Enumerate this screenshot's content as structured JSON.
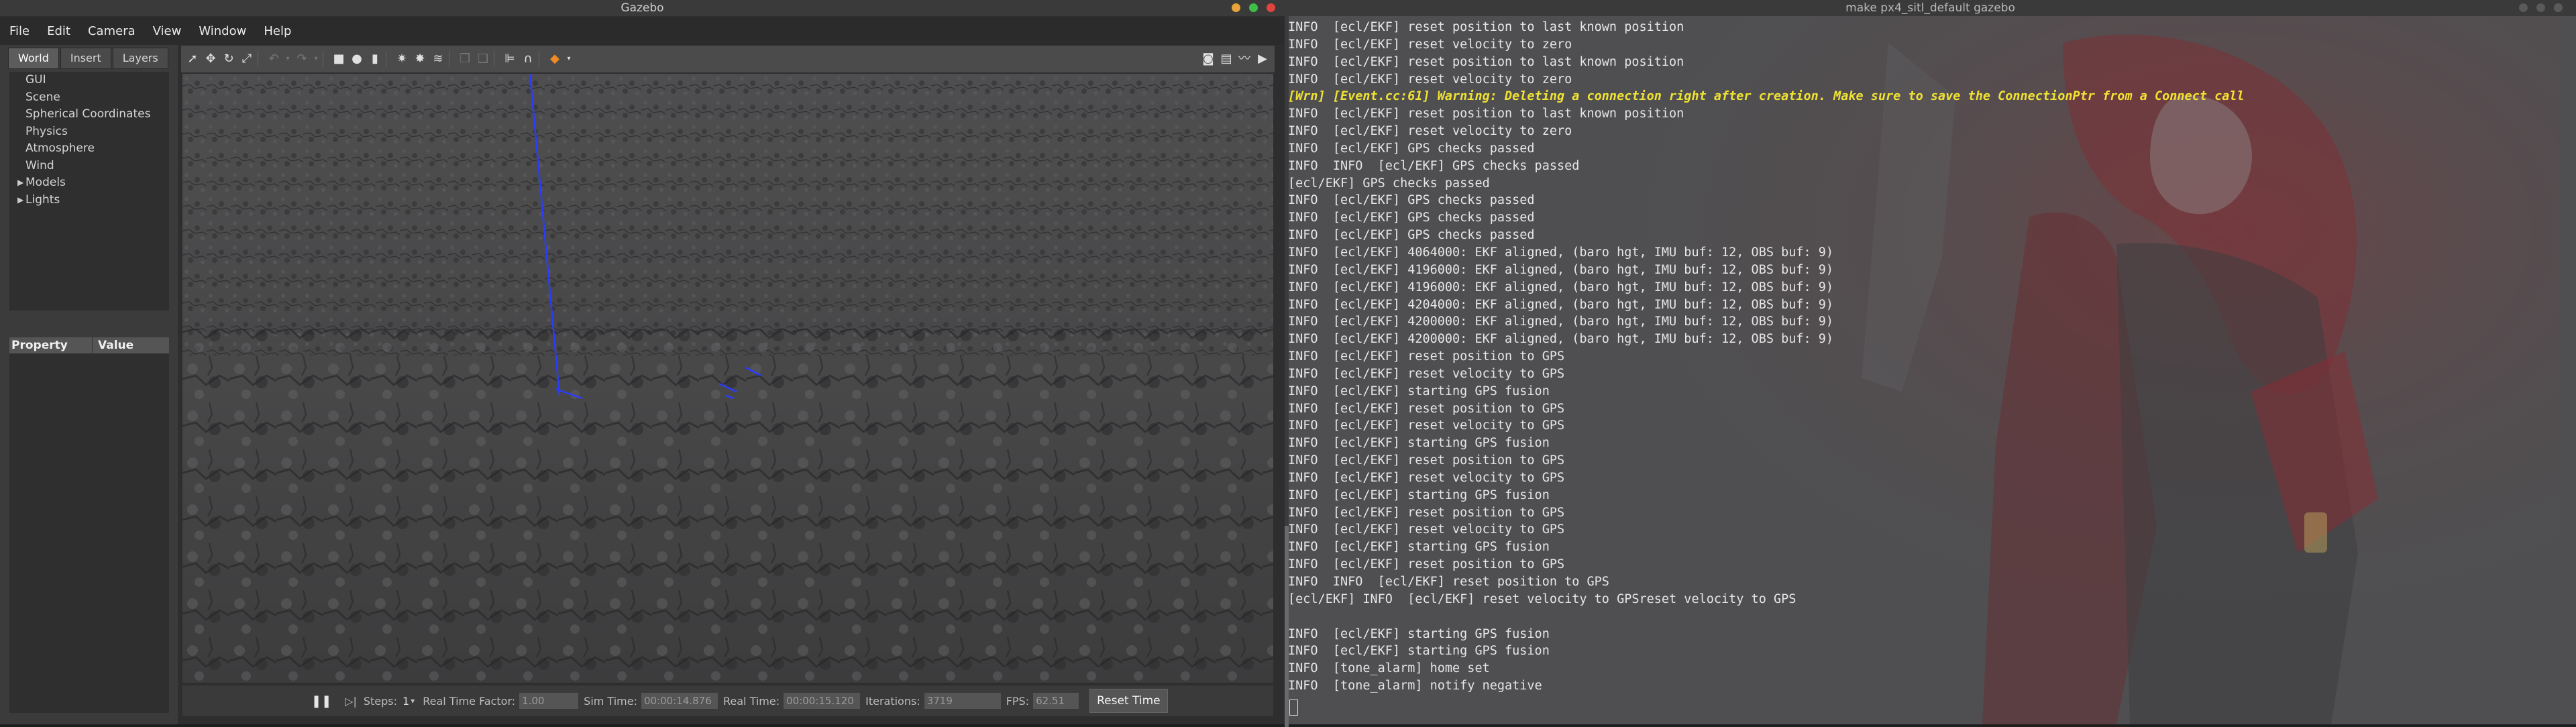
{
  "gazebo": {
    "title": "Gazebo",
    "menu": [
      "File",
      "Edit",
      "Camera",
      "View",
      "Window",
      "Help"
    ],
    "tabs": [
      "World",
      "Insert",
      "Layers"
    ],
    "tree": [
      {
        "label": "GUI",
        "expandable": false
      },
      {
        "label": "Scene",
        "expandable": false
      },
      {
        "label": "Spherical Coordinates",
        "expandable": false
      },
      {
        "label": "Physics",
        "expandable": false
      },
      {
        "label": "Atmosphere",
        "expandable": false
      },
      {
        "label": "Wind",
        "expandable": false
      },
      {
        "label": "Models",
        "expandable": true
      },
      {
        "label": "Lights",
        "expandable": true
      }
    ],
    "props": {
      "col1": "Property",
      "col2": "Value"
    },
    "bottom": {
      "steps_label": "Steps:",
      "steps_value": "1",
      "rtf_label": "Real Time Factor:",
      "rtf_value": "1.00",
      "sim_time_label": "Sim Time:",
      "sim_time_value": "00:00:14.876",
      "real_time_label": "Real Time:",
      "real_time_value": "00:00:15.120",
      "iterations_label": "Iterations:",
      "iterations_value": "3719",
      "fps_label": "FPS:",
      "fps_value": "62.51",
      "reset_label": "Reset Time"
    }
  },
  "terminal": {
    "title": "make px4_sitl_default gazebo",
    "lines": [
      {
        "text": "INFO  [ecl/EKF] reset position to last known position",
        "style": "normal"
      },
      {
        "text": "INFO  [ecl/EKF] reset velocity to zero",
        "style": "normal"
      },
      {
        "text": "INFO  [ecl/EKF] reset position to last known position",
        "style": "normal"
      },
      {
        "text": "INFO  [ecl/EKF] reset velocity to zero",
        "style": "normal"
      },
      {
        "text": "[Wrn] [Event.cc:61] Warning: Deleting a connection right after creation. Make sure to save the ConnectionPtr from a Connect call",
        "style": "warn"
      },
      {
        "text": "INFO  [ecl/EKF] reset position to last known position",
        "style": "normal"
      },
      {
        "text": "INFO  [ecl/EKF] reset velocity to zero",
        "style": "normal"
      },
      {
        "text": "INFO  [ecl/EKF] GPS checks passed",
        "style": "normal"
      },
      {
        "text": "INFO  INFO  [ecl/EKF] GPS checks passed",
        "style": "normal"
      },
      {
        "text": "[ecl/EKF] GPS checks passed",
        "style": "normal"
      },
      {
        "text": "INFO  [ecl/EKF] GPS checks passed",
        "style": "normal"
      },
      {
        "text": "INFO  [ecl/EKF] GPS checks passed",
        "style": "normal"
      },
      {
        "text": "INFO  [ecl/EKF] GPS checks passed",
        "style": "normal"
      },
      {
        "text": "INFO  [ecl/EKF] 4064000: EKF aligned, (baro hgt, IMU buf: 12, OBS buf: 9)",
        "style": "normal"
      },
      {
        "text": "INFO  [ecl/EKF] 4196000: EKF aligned, (baro hgt, IMU buf: 12, OBS buf: 9)",
        "style": "normal"
      },
      {
        "text": "INFO  [ecl/EKF] 4196000: EKF aligned, (baro hgt, IMU buf: 12, OBS buf: 9)",
        "style": "normal"
      },
      {
        "text": "INFO  [ecl/EKF] 4204000: EKF aligned, (baro hgt, IMU buf: 12, OBS buf: 9)",
        "style": "normal"
      },
      {
        "text": "INFO  [ecl/EKF] 4200000: EKF aligned, (baro hgt, IMU buf: 12, OBS buf: 9)",
        "style": "normal"
      },
      {
        "text": "INFO  [ecl/EKF] 4200000: EKF aligned, (baro hgt, IMU buf: 12, OBS buf: 9)",
        "style": "normal"
      },
      {
        "text": "INFO  [ecl/EKF] reset position to GPS",
        "style": "normal"
      },
      {
        "text": "INFO  [ecl/EKF] reset velocity to GPS",
        "style": "normal"
      },
      {
        "text": "INFO  [ecl/EKF] starting GPS fusion",
        "style": "normal"
      },
      {
        "text": "INFO  [ecl/EKF] reset position to GPS",
        "style": "normal"
      },
      {
        "text": "INFO  [ecl/EKF] reset velocity to GPS",
        "style": "normal"
      },
      {
        "text": "INFO  [ecl/EKF] starting GPS fusion",
        "style": "normal"
      },
      {
        "text": "INFO  [ecl/EKF] reset position to GPS",
        "style": "normal"
      },
      {
        "text": "INFO  [ecl/EKF] reset velocity to GPS",
        "style": "normal"
      },
      {
        "text": "INFO  [ecl/EKF] starting GPS fusion",
        "style": "normal"
      },
      {
        "text": "INFO  [ecl/EKF] reset position to GPS",
        "style": "normal"
      },
      {
        "text": "INFO  [ecl/EKF] reset velocity to GPS",
        "style": "normal"
      },
      {
        "text": "INFO  [ecl/EKF] starting GPS fusion",
        "style": "normal"
      },
      {
        "text": "INFO  [ecl/EKF] reset position to GPS",
        "style": "normal"
      },
      {
        "text": "INFO  INFO  [ecl/EKF] reset position to GPS",
        "style": "normal"
      },
      {
        "text": "[ecl/EKF] INFO  [ecl/EKF] reset velocity to GPSreset velocity to GPS",
        "style": "normal"
      },
      {
        "text": "",
        "style": "normal"
      },
      {
        "text": "INFO  [ecl/EKF] starting GPS fusion",
        "style": "normal"
      },
      {
        "text": "INFO  [ecl/EKF] starting GPS fusion",
        "style": "normal"
      },
      {
        "text": "INFO  [tone_alarm] home set",
        "style": "normal"
      },
      {
        "text": "INFO  [tone_alarm] notify negative",
        "style": "normal"
      }
    ]
  }
}
